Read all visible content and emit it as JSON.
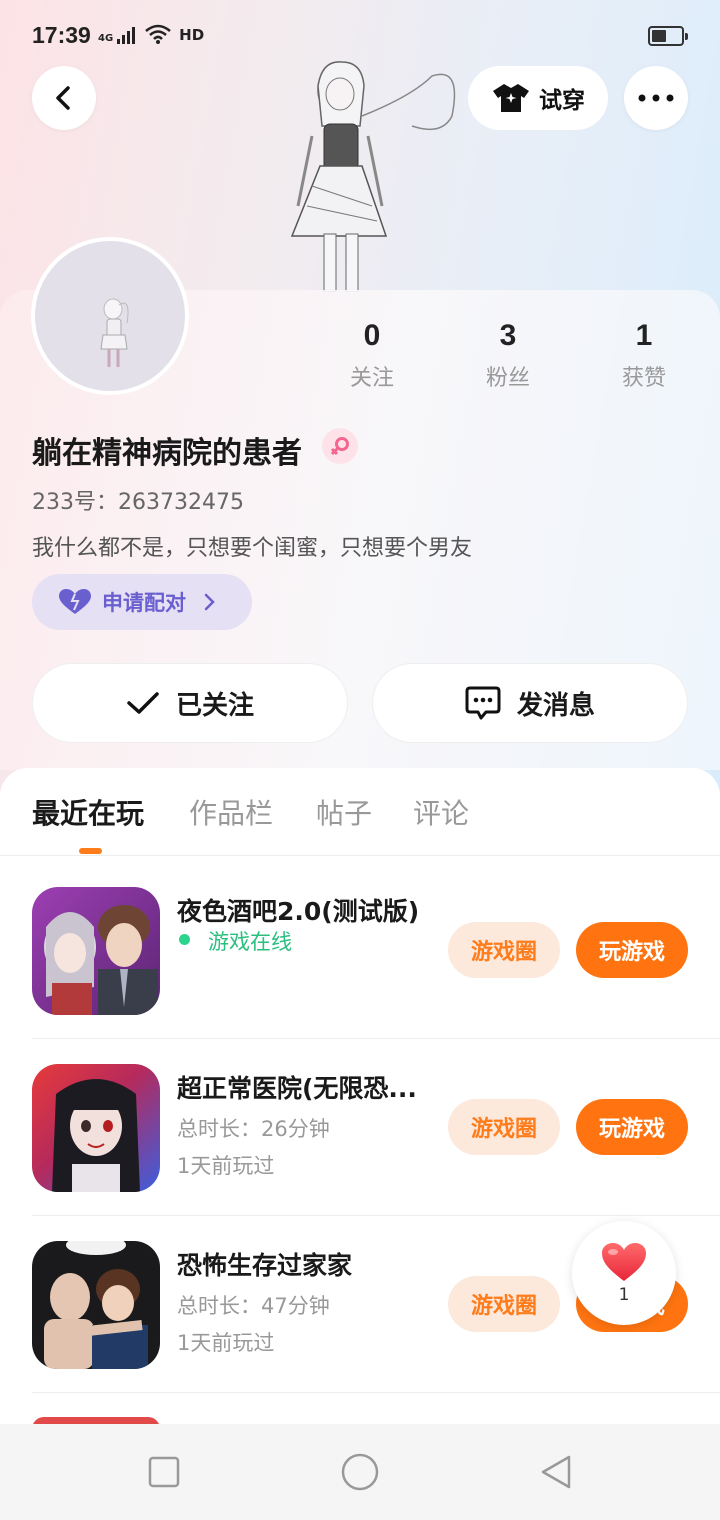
{
  "status_bar": {
    "time": "17:39",
    "network": "4G",
    "hd": "HD"
  },
  "header": {
    "try_on_label": "试穿"
  },
  "profile": {
    "following_count": "0",
    "following_label": "关注",
    "followers_count": "3",
    "followers_label": "粉丝",
    "likes_count": "1",
    "likes_label": "获赞",
    "username": "躺在精神病院的患者",
    "user_id": "233号：263732475",
    "bio": "我什么都不是，只想要个闺蜜，只想要个男友",
    "pair_label": "申请配对",
    "follow_label": "已关注",
    "message_label": "发消息",
    "gender": "female"
  },
  "tabs": [
    {
      "label": "最近在玩",
      "active": true
    },
    {
      "label": "作品栏",
      "active": false
    },
    {
      "label": "帖子",
      "active": false
    },
    {
      "label": "评论",
      "active": false
    }
  ],
  "games": [
    {
      "title": "夜色酒吧2.0(测试版)",
      "status": "游戏在线",
      "circle_label": "游戏圈",
      "play_label": "玩游戏"
    },
    {
      "title": "超正常医院(无限恐...",
      "duration": "总时长：26分钟",
      "last_played": "1天前玩过",
      "circle_label": "游戏圈",
      "play_label": "玩游戏"
    },
    {
      "title": "恐怖生存过家家",
      "duration": "总时长：47分钟",
      "last_played": "1天前玩过",
      "circle_label": "游戏圈",
      "play_label": "玩游戏"
    }
  ],
  "like_float": {
    "count": "1"
  },
  "colors": {
    "accent": "#ff7410",
    "online": "#2bd48c",
    "pair": "#6a5fcf"
  }
}
